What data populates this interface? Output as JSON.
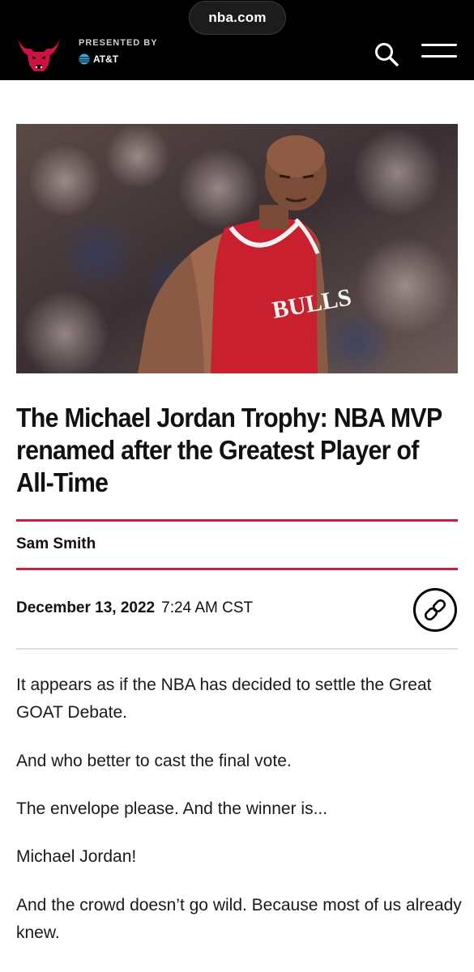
{
  "browser": {
    "url": "nba.com"
  },
  "header": {
    "presented_by": "PRESENTED BY",
    "sponsor": "AT&T",
    "logo_icon": "bulls-logo-icon",
    "search_icon": "search-icon",
    "menu_icon": "hamburger-menu-icon",
    "brand_color": "#ce1141"
  },
  "article": {
    "title": "The Michael Jordan Trophy: NBA MVP renamed after the Greatest Player of All-Time",
    "author": "Sam Smith",
    "date": "December 13, 2022",
    "time": "7:24 AM CST",
    "share_icon": "link-icon",
    "accent_color": "#c4203f",
    "paragraphs": [
      "It appears as if the NBA has decided to settle the Great GOAT Debate.",
      "And who better to cast the final vote.",
      "The envelope please. And the winner is...",
      "Michael Jordan!",
      "And the crowd doesn’t go wild. Because most of us already knew."
    ]
  }
}
